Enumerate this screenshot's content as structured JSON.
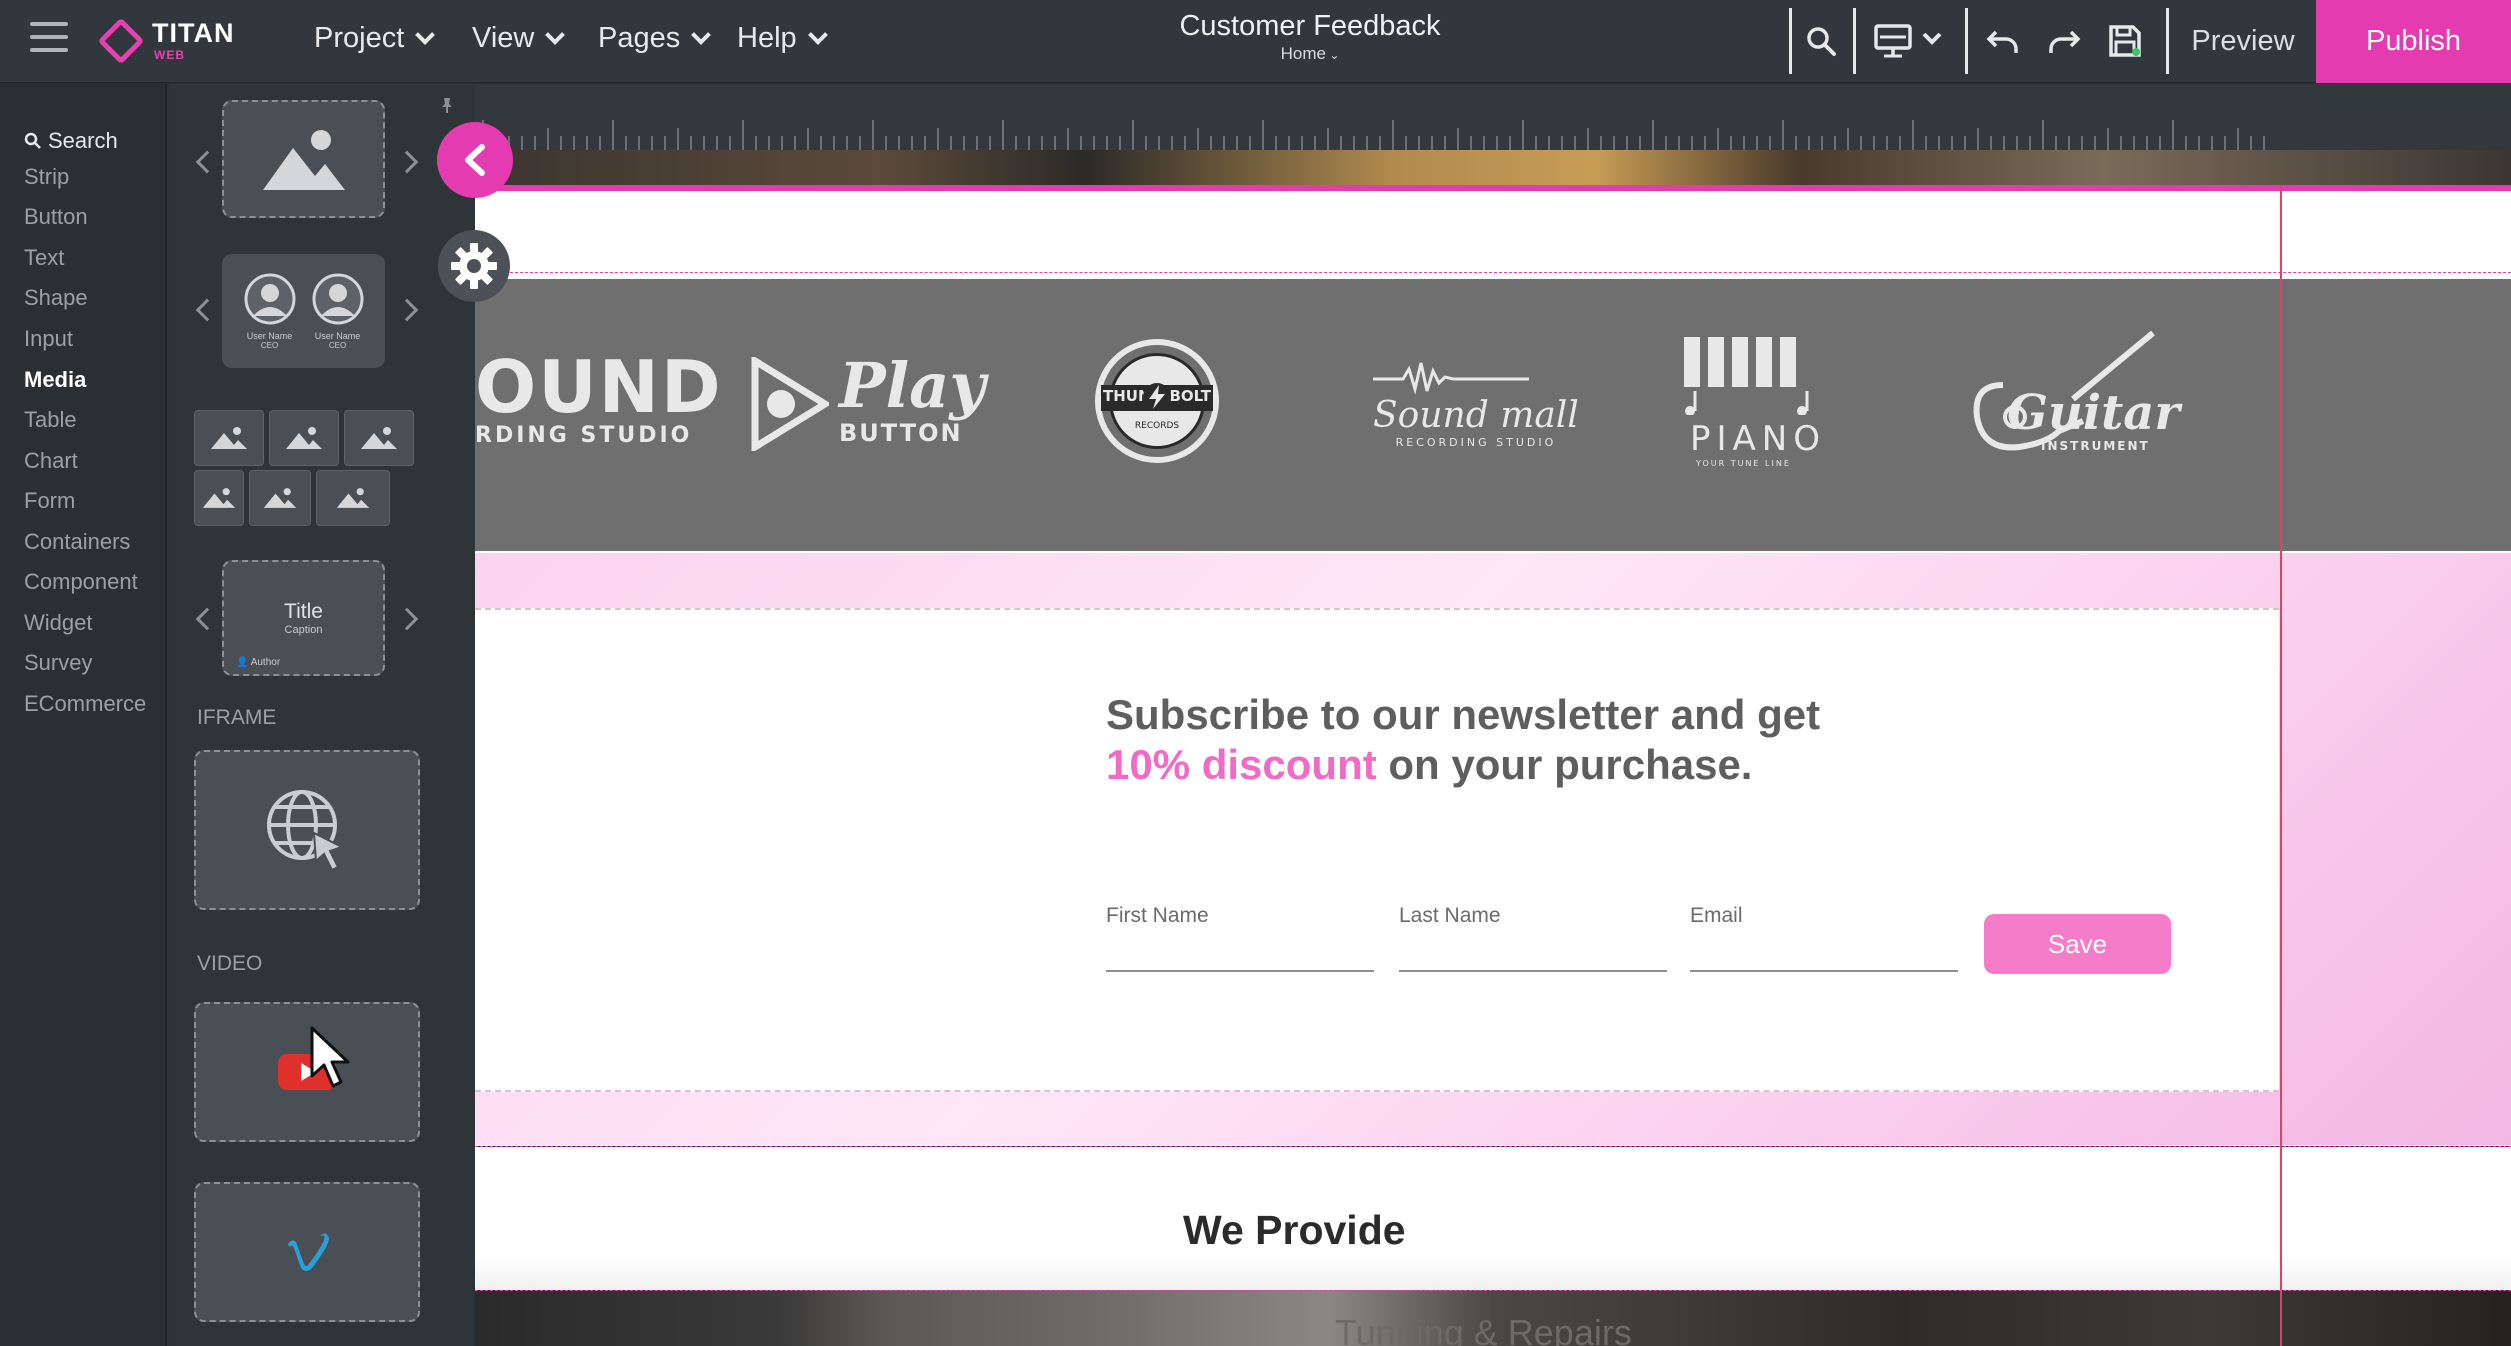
{
  "app": {
    "name": "TITAN",
    "sub": "WEB"
  },
  "menus": [
    "Project",
    "View",
    "Pages",
    "Help"
  ],
  "project": {
    "title": "Customer Feedback",
    "page": "Home"
  },
  "toolbar": {
    "preview_label": "Preview",
    "publish_label": "Publish"
  },
  "categories": {
    "search_label": "Search",
    "items": [
      "Strip",
      "Button",
      "Text",
      "Shape",
      "Input",
      "Media",
      "Table",
      "Chart",
      "Form",
      "Containers",
      "Component",
      "Widget",
      "Survey",
      "ECommerce"
    ],
    "active": "Media"
  },
  "media_panel": {
    "avatar_card": {
      "name1": "User Name",
      "role1": "CEO",
      "name2": "User Name",
      "role2": "CEO"
    },
    "title_card": {
      "title": "Title",
      "caption": "Caption",
      "author": "Author"
    },
    "iframe_label": "IFRAME",
    "video_label": "VIDEO"
  },
  "brands": {
    "sound": {
      "main": "OUND",
      "sub": "RDING STUDIO"
    },
    "play": {
      "main": "Play",
      "sub": "BUTTON"
    },
    "thunderbolt": {
      "left": "THUN",
      "right": "BOLT",
      "sub": "RECORDS"
    },
    "soundmall": {
      "main": "Sound mall",
      "sub": "RECORDING STUDIO"
    },
    "piano": {
      "main": "PIANO",
      "sub": "YOUR TUNE LINE"
    },
    "guitar": {
      "main": "Guitar",
      "sub": "INSTRUMENT"
    }
  },
  "newsletter": {
    "line1": "Subscribe to our newsletter and get",
    "highlight": "10% discount",
    "line2_rest": " on your purchase.",
    "first_name": "First Name",
    "last_name": "Last Name",
    "email": "Email",
    "save_label": "Save"
  },
  "provide": {
    "title": "We Provide",
    "tuning": "Tunning & Repairs"
  },
  "colors": {
    "accent": "#e53bb0",
    "discount": "#f06bc5",
    "save": "#f47cc9",
    "topbar": "#31373d"
  }
}
